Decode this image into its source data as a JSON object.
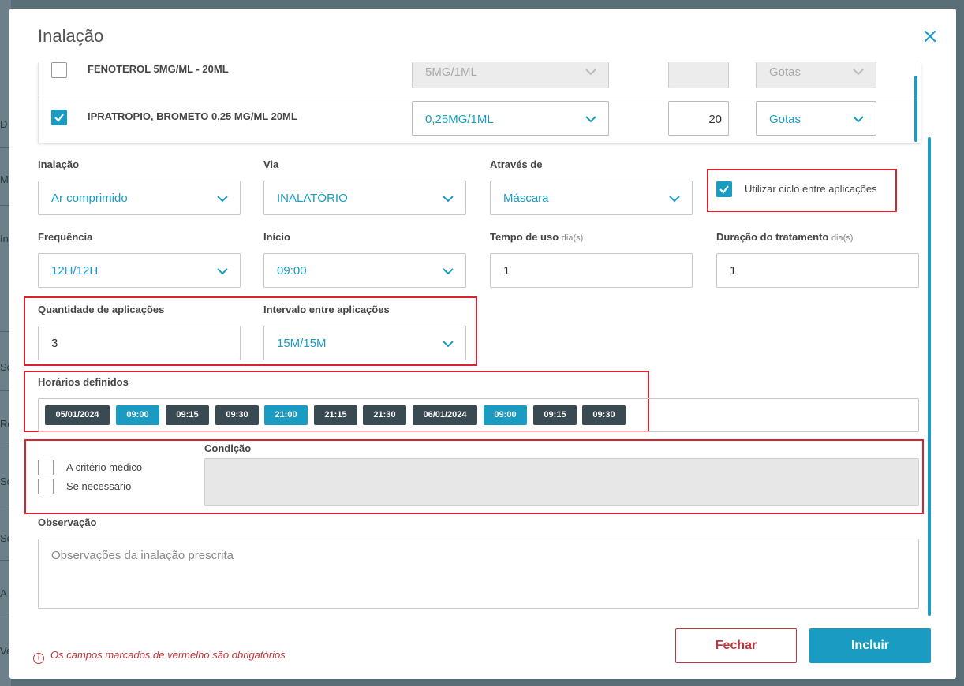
{
  "background": {
    "letters": [
      "D",
      "M",
      "In",
      "Sc",
      "Re",
      "Sc",
      "Sc",
      "A",
      "Ve"
    ]
  },
  "modal": {
    "title": "Inalação"
  },
  "medications": [
    {
      "name": "FENOTEROL 5MG/ML - 20ML",
      "checked": false,
      "dose": "5MG/1ML",
      "quantity": "",
      "unit": "Gotas",
      "disabled": true
    },
    {
      "name": "IPRATROPIO, BROMETO 0,25 MG/ML 20ML",
      "checked": true,
      "dose": "0,25MG/1ML",
      "quantity": "20",
      "unit": "Gotas",
      "disabled": false
    }
  ],
  "form": {
    "inalacao": {
      "label": "Inalação",
      "value": "Ar comprimido"
    },
    "via": {
      "label": "Via",
      "value": "INALATÓRIO"
    },
    "atraves": {
      "label": "Através de",
      "value": "Máscara"
    },
    "ciclo": {
      "label": "Utilizar ciclo entre aplicações",
      "checked": true
    },
    "frequencia": {
      "label": "Frequência",
      "value": "12H/12H"
    },
    "inicio": {
      "label": "Início",
      "value": "09:00"
    },
    "tempo_uso": {
      "label": "Tempo de uso",
      "unit": "dia(s)",
      "value": "1"
    },
    "duracao": {
      "label": "Duração do tratamento",
      "unit": "dia(s)",
      "value": "1"
    },
    "quantidade": {
      "label": "Quantidade de aplicações",
      "value": "3"
    },
    "intervalo": {
      "label": "Intervalo entre aplicações",
      "value": "15M/15M"
    },
    "horarios": {
      "label": "Horários definidos",
      "chips": [
        {
          "text": "05/01/2024",
          "kind": "date"
        },
        {
          "text": "09:00",
          "kind": "main"
        },
        {
          "text": "09:15",
          "kind": "sub"
        },
        {
          "text": "09:30",
          "kind": "sub"
        },
        {
          "text": "21:00",
          "kind": "main"
        },
        {
          "text": "21:15",
          "kind": "sub"
        },
        {
          "text": "21:30",
          "kind": "sub"
        },
        {
          "text": "06/01/2024",
          "kind": "date"
        },
        {
          "text": "09:00",
          "kind": "main"
        },
        {
          "text": "09:15",
          "kind": "sub"
        },
        {
          "text": "09:30",
          "kind": "sub"
        }
      ]
    },
    "criterio": {
      "label": "A critério médico",
      "checked": false
    },
    "necessario": {
      "label": "Se necessário",
      "checked": false
    },
    "condicao": {
      "label": "Condição",
      "value": ""
    },
    "observacao": {
      "label": "Observação",
      "placeholder": "Observações da inalação prescrita"
    }
  },
  "footer": {
    "note": "Os campos marcados de vermelho são obrigatórios",
    "close_label": "Fechar",
    "include_label": "Incluir"
  },
  "colors": {
    "accent": "#1a9bc2",
    "required": "#d8242f",
    "chip_dark": "#3a4a52"
  }
}
